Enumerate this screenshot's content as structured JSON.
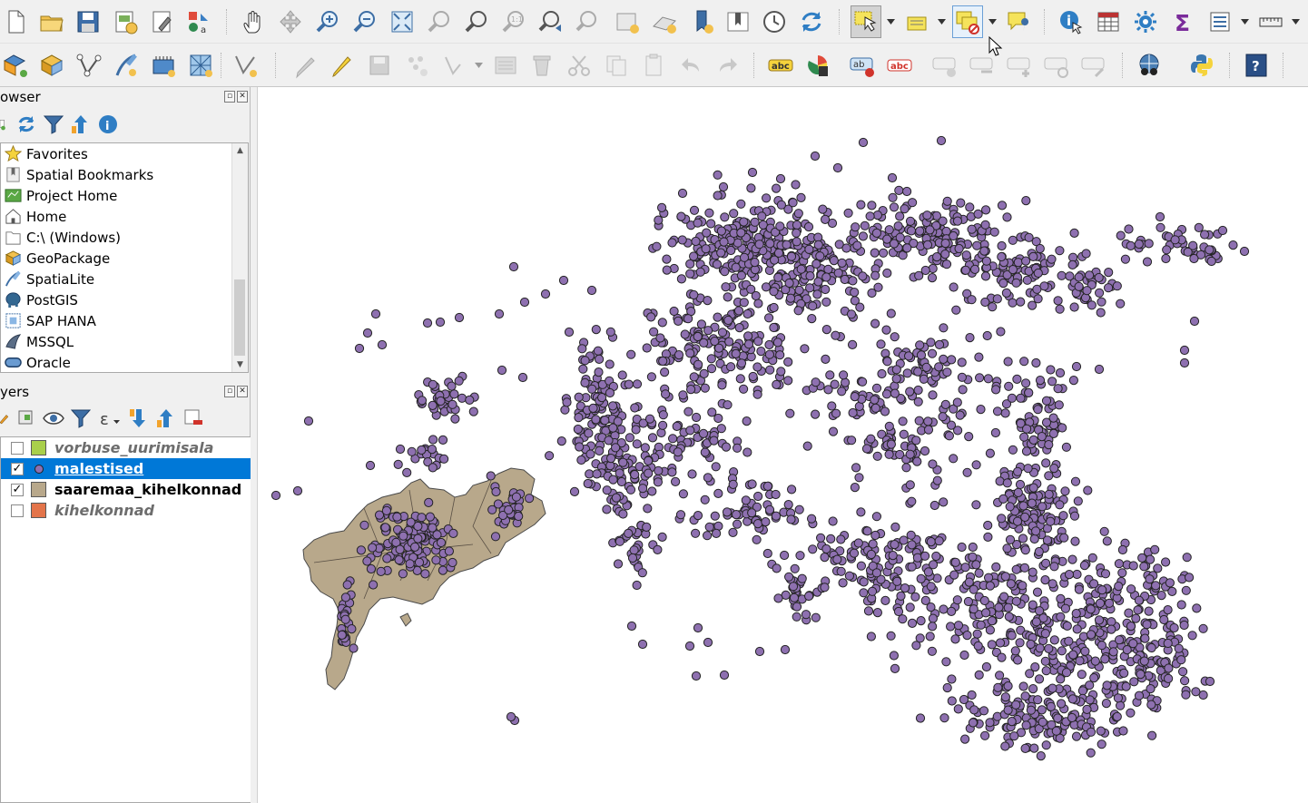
{
  "toolbar_top": {
    "icons": [
      "new-project-icon",
      "open-project-icon",
      "save-project-icon",
      "new-print-layout-icon",
      "layout-manager-icon",
      "style-manager-icon",
      "pan-icon",
      "pan-to-selection-icon",
      "zoom-in-icon",
      "zoom-out-icon",
      "zoom-full-icon",
      "zoom-to-selection-icon",
      "zoom-to-layer-icon",
      "zoom-native-icon",
      "zoom-last-icon",
      "zoom-next-icon",
      "new-map-view-icon",
      "new-3d-map-view-icon",
      "new-bookmark-icon",
      "show-bookmarks-icon",
      "temporal-controller-icon",
      "refresh-icon",
      "select-features-icon",
      "select-by-value-icon",
      "deselect-icon",
      "show-map-tips-icon",
      "identify-icon",
      "attribute-table-icon",
      "toolbox-icon",
      "statistics-icon",
      "open-field-calculator-icon",
      "measure-icon"
    ]
  },
  "toolbar_bottom": {
    "icons": [
      "data-source-manager-icon",
      "new-geopackage-layer-icon",
      "digitize-vector-icon",
      "gps-icon",
      "virtual-layer-icon",
      "mesh-layer-icon",
      "vertex-tool-icon",
      "current-edits-icon",
      "toggle-editing-icon",
      "save-edits-icon",
      "add-feature-icon",
      "move-feature-icon",
      "vertex-editor-icon",
      "delete-selected-icon",
      "cut-features-icon",
      "copy-features-icon",
      "paste-features-icon",
      "undo-icon",
      "redo-icon",
      "label-tool-icon",
      "diagram-tool-icon",
      "highlight-pinned-labels-icon",
      "pin-labels-icon",
      "show-hide-labels-icon",
      "move-label-icon",
      "rotate-label-icon",
      "change-label-icon",
      "metasearch-icon",
      "python-console-icon",
      "help-icon"
    ]
  },
  "browser_panel": {
    "title": "owser",
    "items": [
      {
        "label": "Favorites",
        "icon": "favorites-star-icon"
      },
      {
        "label": "Spatial Bookmarks",
        "icon": "spatial-bookmarks-icon"
      },
      {
        "label": "Project Home",
        "icon": "project-home-icon"
      },
      {
        "label": "Home",
        "icon": "home-folder-icon"
      },
      {
        "label": "C:\\ (Windows)",
        "icon": "drive-folder-icon"
      },
      {
        "label": "GeoPackage",
        "icon": "geopackage-icon"
      },
      {
        "label": "SpatiaLite",
        "icon": "spatialite-icon"
      },
      {
        "label": "PostGIS",
        "icon": "postgis-icon"
      },
      {
        "label": "SAP HANA",
        "icon": "sap-hana-icon"
      },
      {
        "label": "MSSQL",
        "icon": "mssql-icon"
      },
      {
        "label": "Oracle",
        "icon": "oracle-icon"
      }
    ]
  },
  "layers_panel": {
    "title": "yers",
    "layers": [
      {
        "name": "vorbuse_uurimisala",
        "checked": false,
        "selected": false,
        "italic": true,
        "swatch": "#a9cf4b",
        "symbol": "polygon"
      },
      {
        "name": "malestised",
        "checked": true,
        "selected": true,
        "italic": false,
        "swatch": "#8e70b0",
        "symbol": "point"
      },
      {
        "name": "saaremaa_kihelkonnad",
        "checked": true,
        "selected": false,
        "italic": false,
        "swatch": "#b8a88b",
        "symbol": "polygon"
      },
      {
        "name": "kihelkonnad",
        "checked": false,
        "selected": false,
        "italic": true,
        "swatch": "#e3744a",
        "symbol": "polygon"
      }
    ]
  },
  "map": {
    "point_color": "#8e70b0",
    "point_stroke": "#232323",
    "polygon_fill": "#b8a88b"
  }
}
